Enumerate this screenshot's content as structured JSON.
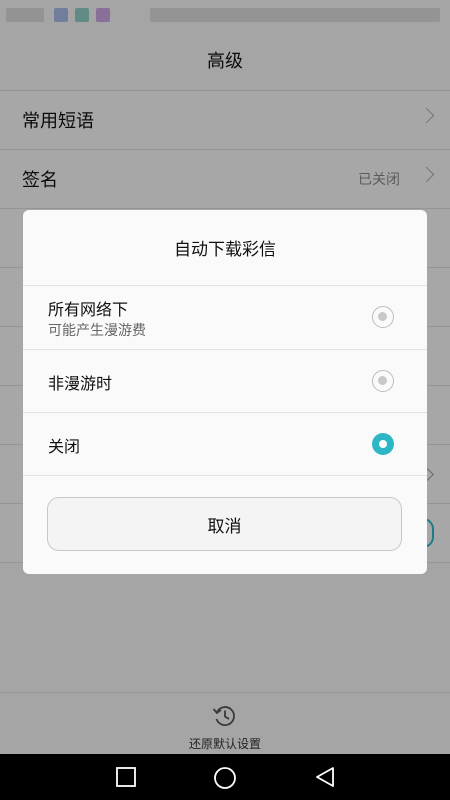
{
  "header": {
    "title": "高级"
  },
  "list": [
    {
      "label": "常用短语",
      "value": ""
    },
    {
      "label": "签名",
      "value": "已关闭"
    }
  ],
  "dialog": {
    "title": "自动下载彩信",
    "options": [
      {
        "label": "所有网络下",
        "sublabel": "可能产生漫游费",
        "selected": false
      },
      {
        "label": "非漫游时",
        "sublabel": "",
        "selected": false
      },
      {
        "label": "关闭",
        "sublabel": "",
        "selected": true
      }
    ],
    "cancel_label": "取消"
  },
  "footer": {
    "restore_label": "还原默认设置"
  },
  "colors": {
    "accent": "#2db7c6"
  },
  "icons": [
    "restore-icon",
    "square-nav-icon",
    "circle-nav-icon",
    "back-nav-icon"
  ]
}
